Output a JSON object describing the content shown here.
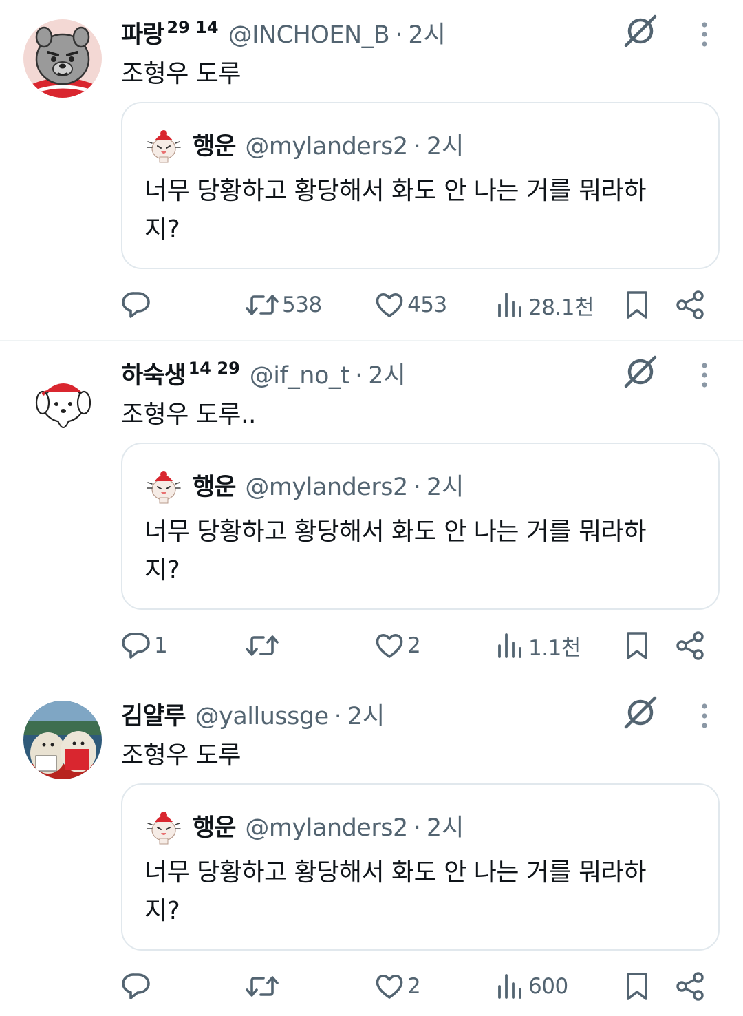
{
  "tweets": [
    {
      "name": "파랑",
      "name_suffix": "29 14",
      "handle": "@INCHOEN_B",
      "time": "2시",
      "text": "조형우 도루",
      "avatar": "gray-cartoon-character-avatar",
      "quote": {
        "name": "행운",
        "handle": "@mylanders2",
        "time": "2시",
        "text": "너무 당황하고 황당해서 화도 안 나는 거를 뭐라하지?"
      },
      "replies": "",
      "retweets": "538",
      "likes": "453",
      "views": "28.1천"
    },
    {
      "name": "하숙생",
      "name_suffix": "14 29",
      "handle": "@if_no_t",
      "time": "2시",
      "text": "조형우 도루..",
      "avatar": "white-dog-red-cap-avatar",
      "quote": {
        "name": "행운",
        "handle": "@mylanders2",
        "time": "2시",
        "text": "너무 당황하고 황당해서 화도 안 나는 거를 뭐라하지?"
      },
      "replies": "1",
      "retweets": "",
      "likes": "2",
      "views": "1.1천"
    },
    {
      "name": "김얄루",
      "name_suffix": "",
      "handle": "@yallussge",
      "time": "2시",
      "text": "조형우 도루",
      "avatar": "plush-toys-stadium-avatar",
      "quote": {
        "name": "행운",
        "handle": "@mylanders2",
        "time": "2시",
        "text": "너무 당황하고 황당해서 화도 안 나는 거를 뭐라하지?"
      },
      "replies": "",
      "retweets": "",
      "likes": "2",
      "views": "600"
    }
  ],
  "icons": {
    "grok": "grok-icon",
    "more": "more-vertical-icon",
    "reply": "reply-icon",
    "retweet": "retweet-icon",
    "like": "heart-icon",
    "views": "views-chart-icon",
    "bookmark": "bookmark-icon",
    "share": "share-icon"
  },
  "colors": {
    "text_primary": "#0f1419",
    "text_secondary": "#536471",
    "border": "#e1e8ed",
    "accent_red": "#d9262f"
  }
}
